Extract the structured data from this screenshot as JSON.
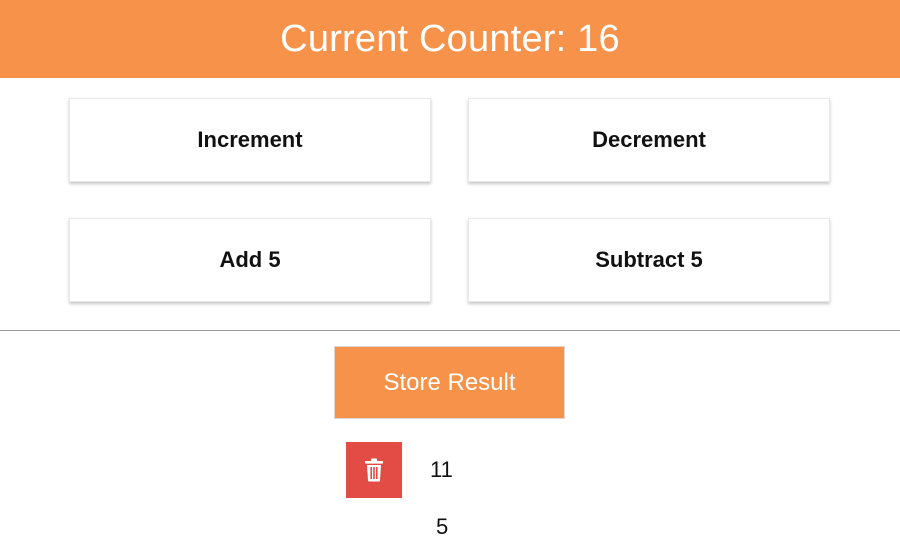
{
  "header": {
    "title": "Current Counter: 16"
  },
  "operations": [
    {
      "label": "Increment"
    },
    {
      "label": "Decrement"
    },
    {
      "label": "Add 5"
    },
    {
      "label": "Subtract 5"
    }
  ],
  "store": {
    "label": "Store Result"
  },
  "results": [
    {
      "value": "11",
      "has_delete": true,
      "delete_icon": "trash-icon"
    },
    {
      "value": "5",
      "has_delete": false
    }
  ],
  "colors": {
    "accent": "#f7924a",
    "delete": "#e24c44"
  }
}
